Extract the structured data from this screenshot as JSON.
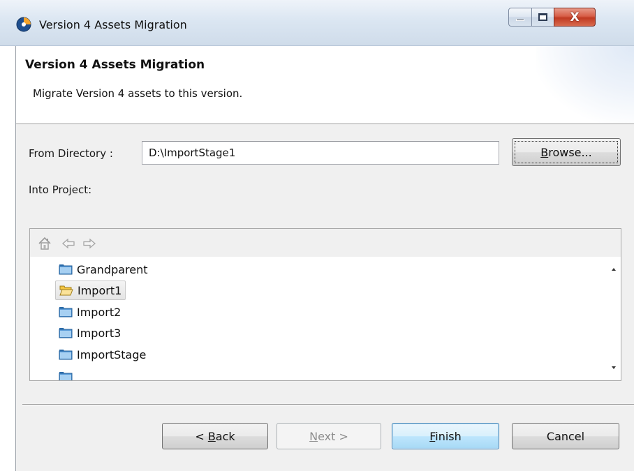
{
  "window": {
    "title": "Version 4 Assets Migration",
    "close_glyph": "X"
  },
  "banner": {
    "title": "Version 4 Assets Migration",
    "description": "Migrate Version 4 assets to this version."
  },
  "form": {
    "from_directory_label": "From Directory :",
    "from_directory_value": "D:\\ImportStage1",
    "browse_label_accel": "B",
    "browse_label_rest": "rowse...",
    "into_project_label": "Into Project:"
  },
  "tree": {
    "toolbar_icons": [
      "home-icon",
      "back-arrow-icon",
      "forward-arrow-icon"
    ],
    "items": [
      {
        "label": "Grandparent",
        "icon": "folder-closed-icon",
        "selected": false
      },
      {
        "label": "Import1",
        "icon": "folder-open-icon",
        "selected": true
      },
      {
        "label": "Import2",
        "icon": "folder-closed-icon",
        "selected": false
      },
      {
        "label": "Import3",
        "icon": "folder-closed-icon",
        "selected": false
      },
      {
        "label": "ImportStage",
        "icon": "folder-closed-icon",
        "selected": false
      }
    ]
  },
  "buttons": {
    "back_prefix": "< ",
    "back_accel": "B",
    "back_rest": "ack",
    "next_accel": "N",
    "next_rest": "ext >",
    "finish_accel": "F",
    "finish_rest": "inish",
    "cancel": "Cancel"
  },
  "colors": {
    "dialog_bg": "#f0f0f0",
    "finish_default_border": "#3c7fb1",
    "close_button": "#c03a22"
  }
}
